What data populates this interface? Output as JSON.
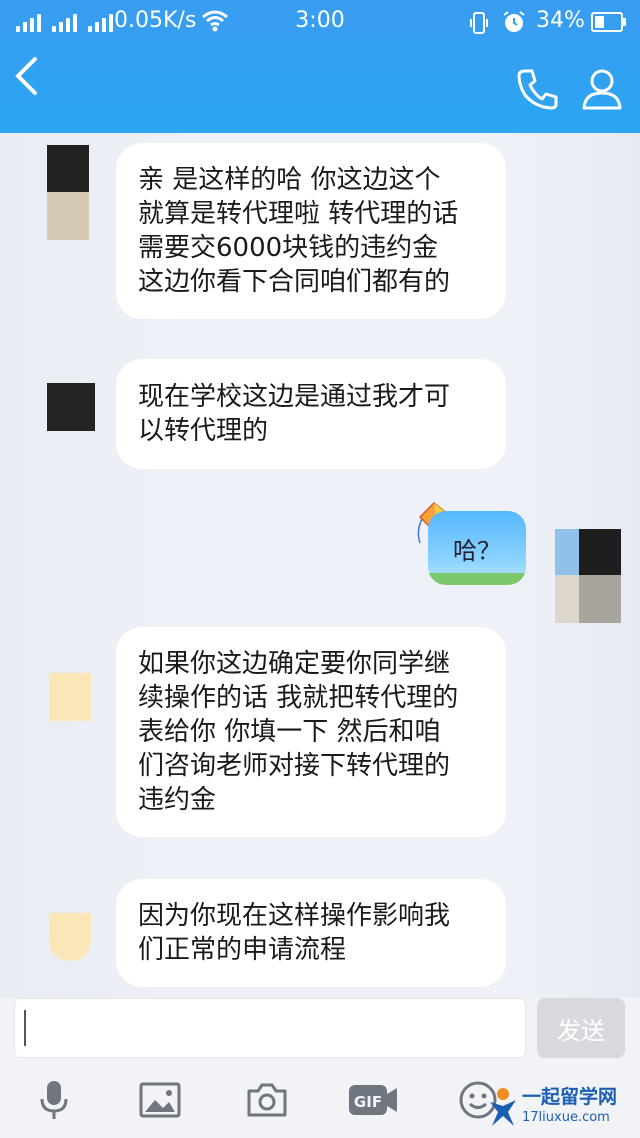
{
  "status_bar": {
    "net_speed": "0.05K/s",
    "time": "3:00",
    "battery": "34%"
  },
  "nav": {
    "back_icon": "chevron-left-icon",
    "call_icon": "phone-icon",
    "profile_icon": "person-icon"
  },
  "messages": [
    {
      "side": "left",
      "lines": [
        "亲 是这样的哈 你这边这个",
        "就算是转代理啦 转代理的话",
        "需要交6000块钱的违约金",
        "这边你看下合同咱们都有的"
      ]
    },
    {
      "side": "left",
      "lines": [
        "现在学校这边是通过我才可",
        "以转代理的"
      ]
    },
    {
      "side": "right",
      "lines": [
        "哈？"
      ]
    },
    {
      "side": "left",
      "lines": [
        "如果你这边确定要你同学继",
        "续操作的话 我就把转代理的",
        "表给你 你填一下 然后和咱",
        "们咨询老师对接下转代理的",
        "违约金"
      ]
    },
    {
      "side": "left",
      "lines": [
        "因为你现在这样操作影响我",
        "们正常的申请流程"
      ]
    }
  ],
  "input": {
    "value": "",
    "send_label": "发送"
  },
  "toolbar": {
    "gif_label": "GIF"
  },
  "watermark": {
    "title": "一起留学网",
    "url": "17liuxue.com"
  },
  "colors": {
    "header": "#2aa6f3",
    "background": "#ecf0f6",
    "bubble": "#ffffff"
  }
}
